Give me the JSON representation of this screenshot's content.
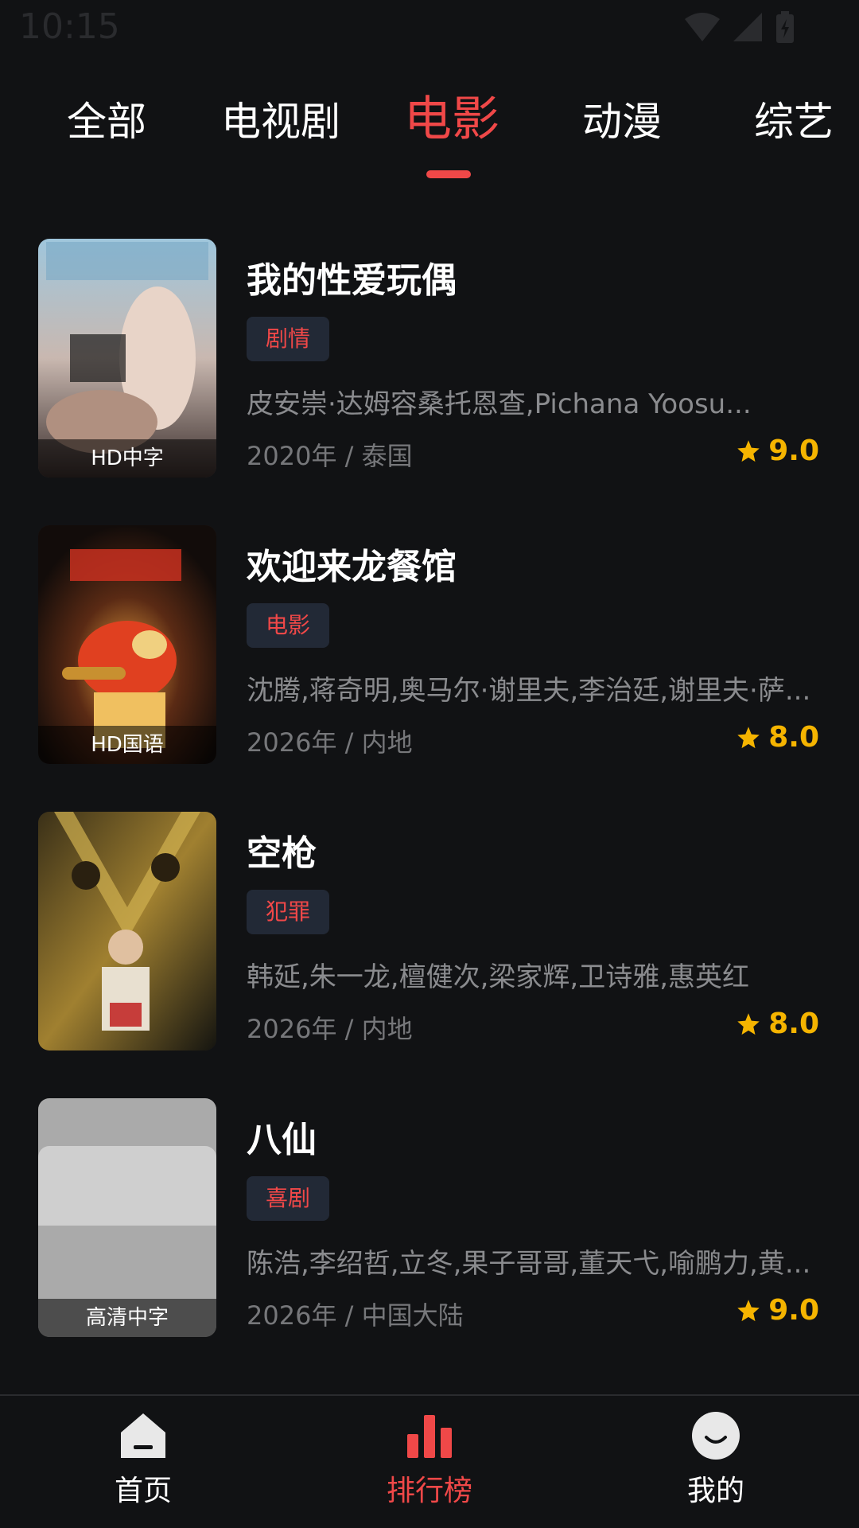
{
  "status_bar": {
    "time": "10:15"
  },
  "tabs": [
    {
      "label": "全部",
      "active": false
    },
    {
      "label": "电视剧",
      "active": false
    },
    {
      "label": "电影",
      "active": true
    },
    {
      "label": "动漫",
      "active": false
    },
    {
      "label": "综艺",
      "active": false
    }
  ],
  "movies": [
    {
      "title": "我的性爱玩偶",
      "genre": "剧情",
      "cast": "皮安崇·达姆容桑托恩查,Pichana Yoosu...",
      "meta": "2020年 / 泰国",
      "rating": "9.0",
      "badge": "HD中字"
    },
    {
      "title": "欢迎来龙餐馆",
      "genre": "电影",
      "cast": "沈腾,蒋奇明,奥马尔·谢里夫,李治廷,谢里夫·萨...",
      "meta": "2026年 / 内地",
      "rating": "8.0",
      "badge": "HD国语"
    },
    {
      "title": "空枪",
      "genre": "犯罪",
      "cast": "韩延,朱一龙,檀健次,梁家辉,卫诗雅,惠英红",
      "meta": "2026年 / 内地",
      "rating": "8.0",
      "badge": ""
    },
    {
      "title": "八仙",
      "genre": "喜剧",
      "cast": "陈浩,李绍哲,立冬,果子哥哥,董天弋,喻鹏力,黄...",
      "meta": "2026年 / 中国大陆",
      "rating": "9.0",
      "badge": "高清中字"
    }
  ],
  "bottom_nav": [
    {
      "label": "首页",
      "icon": "home-icon",
      "active": false
    },
    {
      "label": "排行榜",
      "icon": "ranking-chart-icon",
      "active": true
    },
    {
      "label": "我的",
      "icon": "profile-smile-icon",
      "active": false
    }
  ],
  "colors": {
    "background": "#111214",
    "accent": "#f04848",
    "rating": "#f5b400",
    "tag_background": "#222936",
    "secondary_text": "#8a8b8e"
  }
}
